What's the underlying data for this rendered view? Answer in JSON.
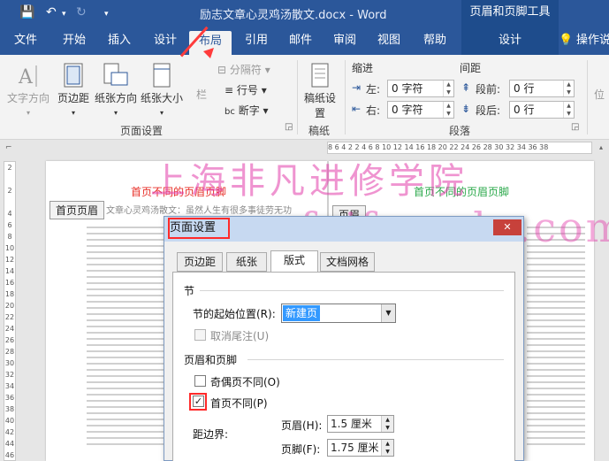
{
  "titlebar": {
    "doc_title": "励志文章心灵鸡汤散文.docx - Word",
    "context_tool": "页眉和页脚工具"
  },
  "tabs": [
    "文件",
    "开始",
    "插入",
    "设计",
    "布局",
    "引用",
    "邮件",
    "审阅",
    "视图",
    "帮助"
  ],
  "context_tab": "设计",
  "tell_me": "操作说",
  "ribbon": {
    "text_direction": "文字方向",
    "margins": "页边距",
    "orientation": "纸张方向",
    "size": "纸张大小",
    "columns": "栏",
    "breaks": "分隔符",
    "line_numbers": "行号",
    "hyphenation": "断字",
    "page_setup_group": "页面设置",
    "manuscript": "稿纸设置",
    "manuscript_group": "稿纸",
    "indent_title": "缩进",
    "spacing_title": "间距",
    "left_label": "左:",
    "right_label": "右:",
    "before_label": "段前:",
    "after_label": "段后:",
    "left_value": "0 字符",
    "right_value": "0 字符",
    "before_value": "0 行",
    "after_value": "0 行",
    "paragraph_group": "段落",
    "position": "位"
  },
  "ruler": {
    "h": "8 6 4 2    2 4 6 8 10 12 14 16 18 20 22 24 26 28 30 32 34 36 38",
    "v": [
      "2",
      "",
      "2",
      "",
      "4",
      "6",
      "8",
      "10",
      "12",
      "14",
      "16",
      "18",
      "20",
      "22",
      "24",
      "26",
      "28",
      "30",
      "32",
      "34",
      "36",
      "38",
      "40",
      "42",
      "44",
      "46"
    ]
  },
  "page": {
    "header_left": "首页不同的页眉页脚",
    "header_right": "首页不同的页眉页脚",
    "first_header_tag": "首页页眉",
    "header_tag": "页眉",
    "line1": "文章心灵鸡汤散文：虽然人生有很多事徒劳无功"
  },
  "watermark": {
    "line1": "上海非凡进修学院",
    "line2": "www.feifanedu.com.cn"
  },
  "dialog": {
    "title": "页面设置",
    "close": "✕",
    "tabs": [
      "页边距",
      "纸张",
      "版式",
      "文档网格"
    ],
    "section_label": "节",
    "section_start_label": "节的起始位置(R):",
    "section_start_value": "新建页",
    "suppress_endnotes": "取消尾注(U)",
    "hf_label": "页眉和页脚",
    "odd_even": "奇偶页不同(O)",
    "first_page": "首页不同(P)",
    "from_edge": "距边界:",
    "header_label": "页眉(H):",
    "header_value": "1.5 厘米",
    "footer_label": "页脚(F):",
    "footer_value": "1.75 厘米",
    "checkmark": "✓"
  },
  "colors": {
    "accent": "#2b579a",
    "header_red": "#e8312a",
    "header_green": "#2aa84a",
    "highlight": "#ff2a2a"
  }
}
